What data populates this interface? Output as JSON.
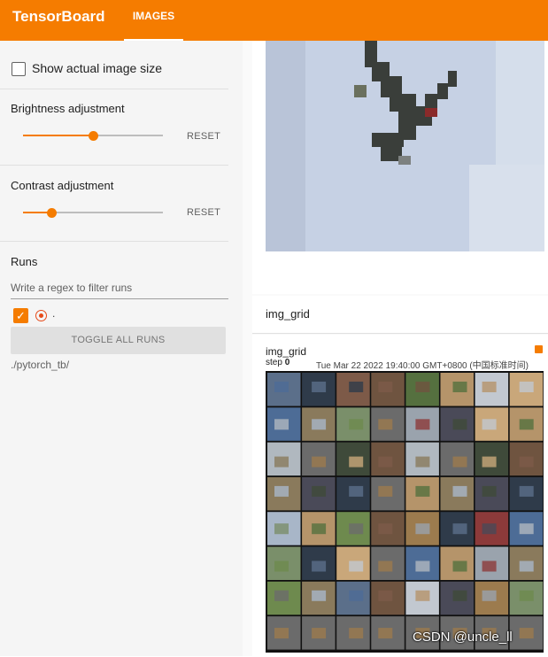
{
  "header": {
    "brand": "TensorBoard",
    "tabs": [
      {
        "label": "IMAGES",
        "active": true
      }
    ],
    "accent_color": "#f57c00"
  },
  "sidebar": {
    "show_actual_size_label": "Show actual image size",
    "show_actual_size_checked": false,
    "brightness": {
      "label": "Brightness adjustment",
      "reset_label": "RESET",
      "level": 0.5
    },
    "contrast": {
      "label": "Contrast adjustment",
      "reset_label": "RESET",
      "level": 0.2
    },
    "runs": {
      "title": "Runs",
      "filter_placeholder": "Write a regex to filter runs",
      "items": [
        {
          "name": ".",
          "checked": true,
          "color": "#e64a19"
        }
      ],
      "toggle_all_label": "TOGGLE ALL RUNS",
      "log_dir": "./pytorch_tb/"
    }
  },
  "main": {
    "first_card_tag": "img_grid",
    "second_card": {
      "tag": "img_grid",
      "step_label": "step",
      "step_value": "0",
      "timestamp": "Tue Mar 22 2022 19:40:00 GMT+0800 (中国标准时间)"
    },
    "watermark": "CSDN @uncle_ll"
  }
}
